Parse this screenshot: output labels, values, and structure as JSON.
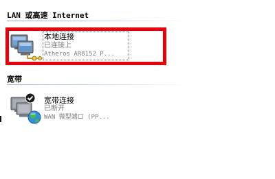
{
  "groups": [
    {
      "header": "LAN 或高速 Internet",
      "items": [
        {
          "name": "本地连接",
          "status": "已连接上",
          "device": "Atheros AR8152 P..."
        }
      ]
    },
    {
      "header": "宽带",
      "items": [
        {
          "name": "宽带连接",
          "status": "已断开",
          "device": "WAN 微型端口 (PP..."
        }
      ]
    }
  ],
  "colors": {
    "highlight": "#e8000b",
    "header_line": "#8fb0d9"
  },
  "icons": {
    "lan": "lan-connection-icon",
    "broadband": "broadband-connection-icon"
  }
}
